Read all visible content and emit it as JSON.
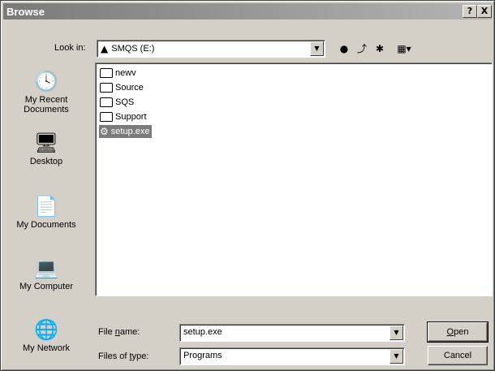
{
  "window": {
    "title": "Browse"
  },
  "titlebar_buttons": {
    "help": "?",
    "close": "X"
  },
  "look_in": {
    "label": "Look in:",
    "value": "SMQS (E:)",
    "drive_icon": "drive-icon"
  },
  "toolbar": {
    "back_icon": "back-icon",
    "up_folder_icon": "up-folder-icon",
    "new_folder_icon": "new-folder-icon",
    "views_icon": "views-menu-icon"
  },
  "places": [
    {
      "label1": "My Recent",
      "label2": "Documents",
      "icon": "recent-documents-icon"
    },
    {
      "label1": "Desktop",
      "label2": "",
      "icon": "desktop-icon"
    },
    {
      "label1": "My Documents",
      "label2": "",
      "icon": "my-documents-icon"
    },
    {
      "label1": "My Computer",
      "label2": "",
      "icon": "my-computer-icon"
    },
    {
      "label1": "My Network",
      "label2": "",
      "icon": "my-network-icon"
    }
  ],
  "files": [
    {
      "name": "newv",
      "type": "folder"
    },
    {
      "name": "Source",
      "type": "folder"
    },
    {
      "name": "SQS",
      "type": "folder"
    },
    {
      "name": "Support",
      "type": "folder"
    },
    {
      "name": "setup.exe",
      "type": "application",
      "selected": true
    }
  ],
  "file_name": {
    "label_pre": "File ",
    "label_acc": "n",
    "label_post": "ame:",
    "value": "setup.exe"
  },
  "file_type": {
    "label_pre": "Files of ",
    "label_acc": "t",
    "label_post": "ype:",
    "value": "Programs"
  },
  "buttons": {
    "open_acc": "O",
    "open_rest": "pen",
    "cancel": "Cancel"
  }
}
